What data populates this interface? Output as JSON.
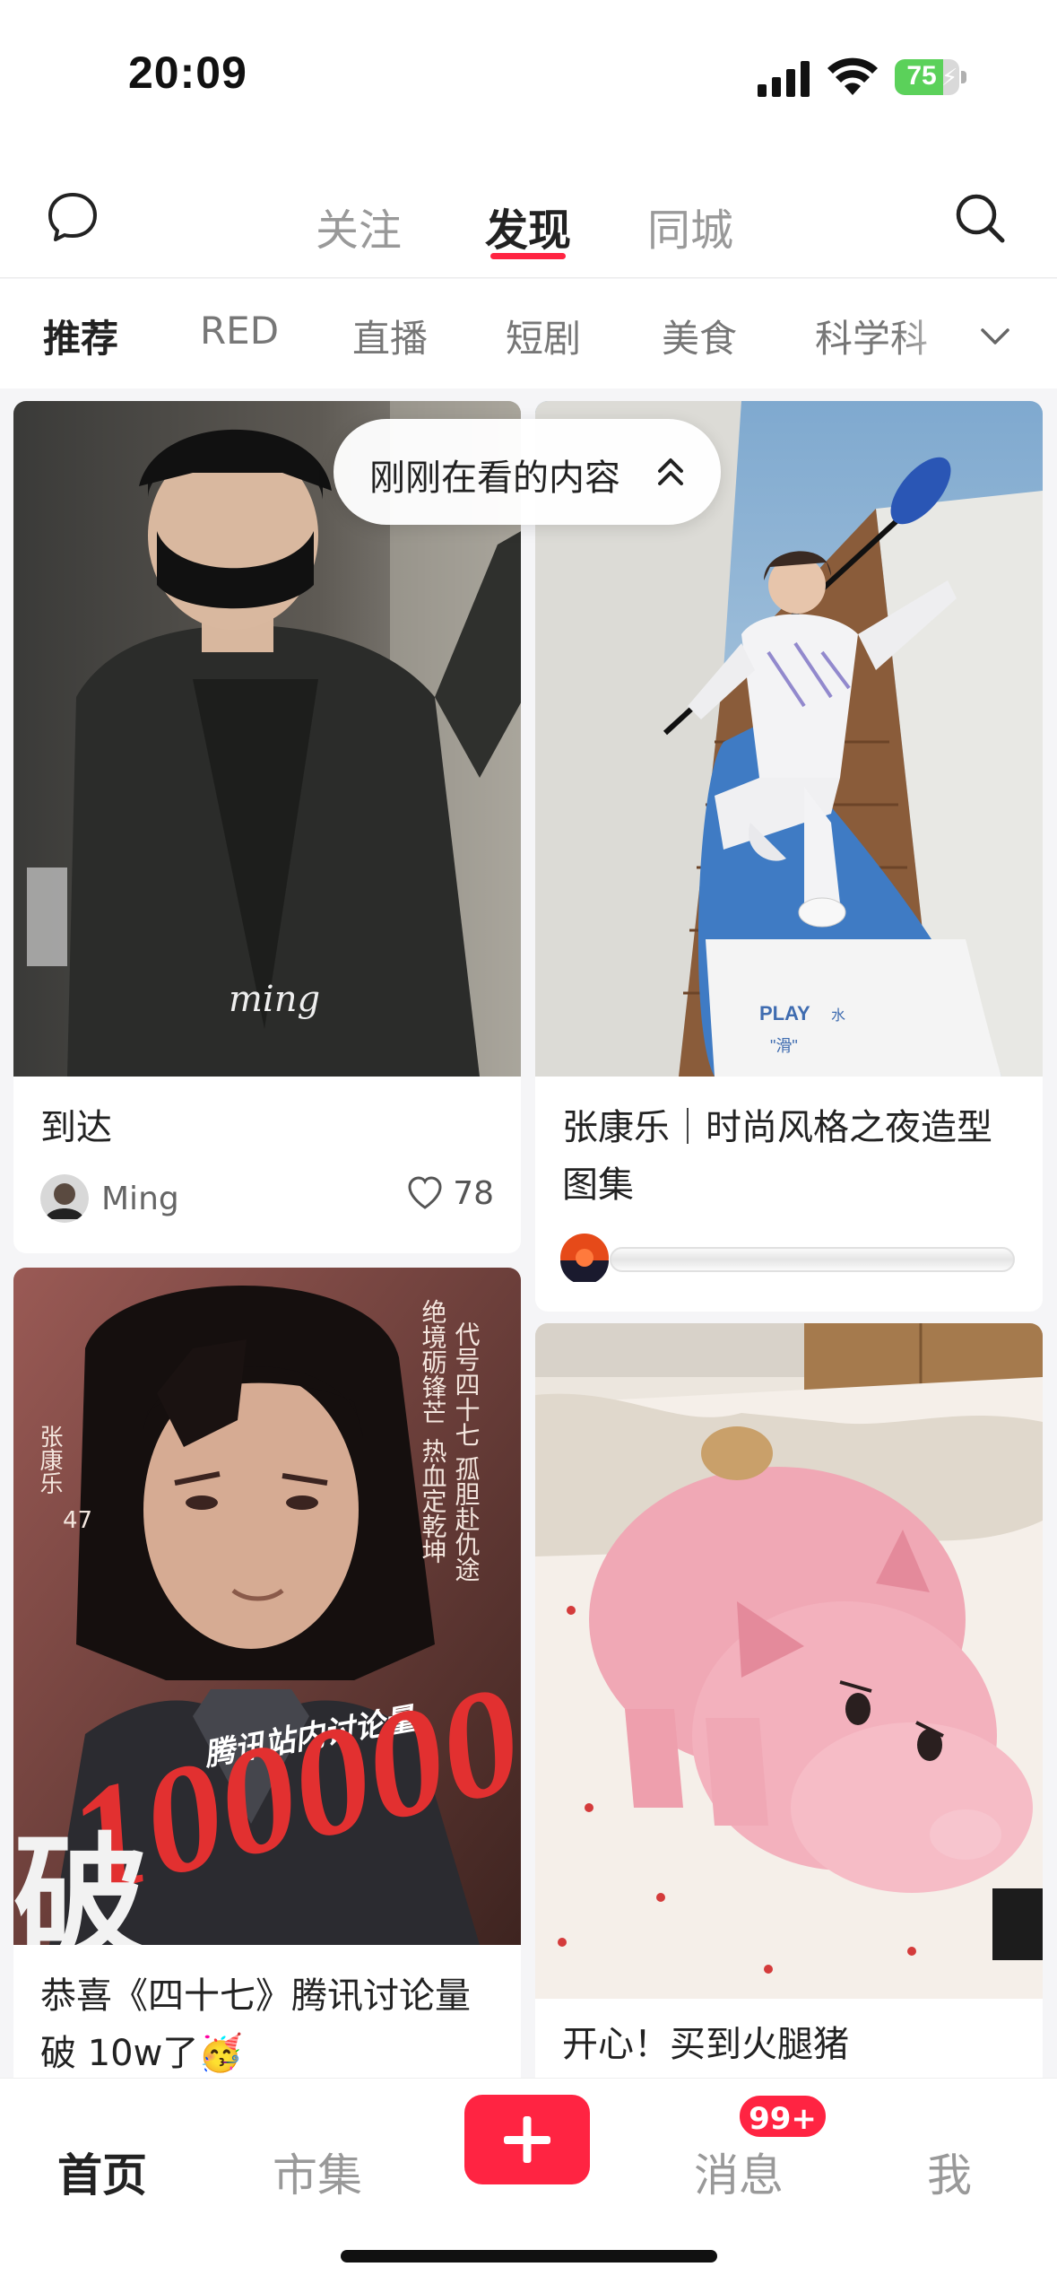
{
  "status_bar": {
    "time": "20:09",
    "battery": "75",
    "battery_level": 0.75
  },
  "top_nav": {
    "tabs": [
      {
        "label": "关注",
        "active": false
      },
      {
        "label": "发现",
        "active": true
      },
      {
        "label": "同城",
        "active": false
      }
    ],
    "accent": "#ff2442"
  },
  "categories": [
    {
      "label": "推荐",
      "active": true
    },
    {
      "label": "RED"
    },
    {
      "label": "直播"
    },
    {
      "label": "短剧"
    },
    {
      "label": "美食"
    },
    {
      "label": "科学科"
    }
  ],
  "popup": {
    "label": "刚刚在看的内容"
  },
  "feed": {
    "cards": [
      {
        "title": "到达",
        "author": "Ming",
        "likes": "78",
        "watermark": "ming"
      },
      {
        "title": "张康乐｜时尚风格之夜造型图集",
        "board_text": "PLAY",
        "board_text_2": "\"滑\"",
        "board_text_3": "水"
      },
      {
        "title": "恭喜《四十七》腾讯讨论量破 10w了🥳",
        "poster_text": "100000",
        "poster_text_2": "破",
        "poster_text_3": "腾讯站内讨论量",
        "poster_vertical_1": "代号四十七",
        "poster_vertical_2": "孤胆赴仇途",
        "poster_vertical_3": "绝境砺锋芒",
        "poster_vertical_4": "热血定乾坤",
        "poster_vertical_5": "张康乐",
        "poster_vertical_6": "47"
      },
      {
        "title": "开心！买到火腿猪"
      }
    ]
  },
  "tab_bar": {
    "items": [
      {
        "label": "首页",
        "active": true
      },
      {
        "label": "市集"
      },
      {
        "label": "消息",
        "badge": "99+"
      },
      {
        "label": "我"
      }
    ]
  }
}
